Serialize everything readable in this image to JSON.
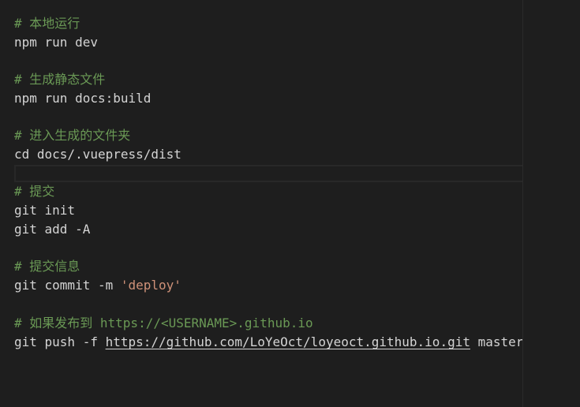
{
  "editor": {
    "lines": [
      {
        "kind": "comment",
        "text": "# 本地运行"
      },
      {
        "kind": "code",
        "text": "npm run dev"
      },
      {
        "kind": "comment",
        "text": "# 生成静态文件"
      },
      {
        "kind": "code",
        "text": "npm run docs:build"
      },
      {
        "kind": "comment",
        "text": "# 进入生成的文件夹"
      },
      {
        "kind": "code",
        "text": "cd docs/.vuepress/dist"
      },
      {
        "kind": "comment",
        "text": "# 提交"
      },
      {
        "kind": "code",
        "text": "git init"
      },
      {
        "kind": "code",
        "text": "git add -A"
      },
      {
        "kind": "comment",
        "text": "# 提交信息"
      },
      {
        "kind": "code",
        "text": "git commit -m ",
        "string": "'deploy'"
      },
      {
        "kind": "comment",
        "text": "# 如果发布到 https://<USERNAME>.github.io"
      },
      {
        "kind": "code",
        "text": "git push -f ",
        "url": "https://github.com/LoYeOct/loyeoct.github.io.git",
        "suffix": " master"
      }
    ]
  },
  "colors": {
    "background": "#1e1e1e",
    "text": "#d4d4d4",
    "comment": "#6a9955",
    "string": "#ce9178"
  }
}
